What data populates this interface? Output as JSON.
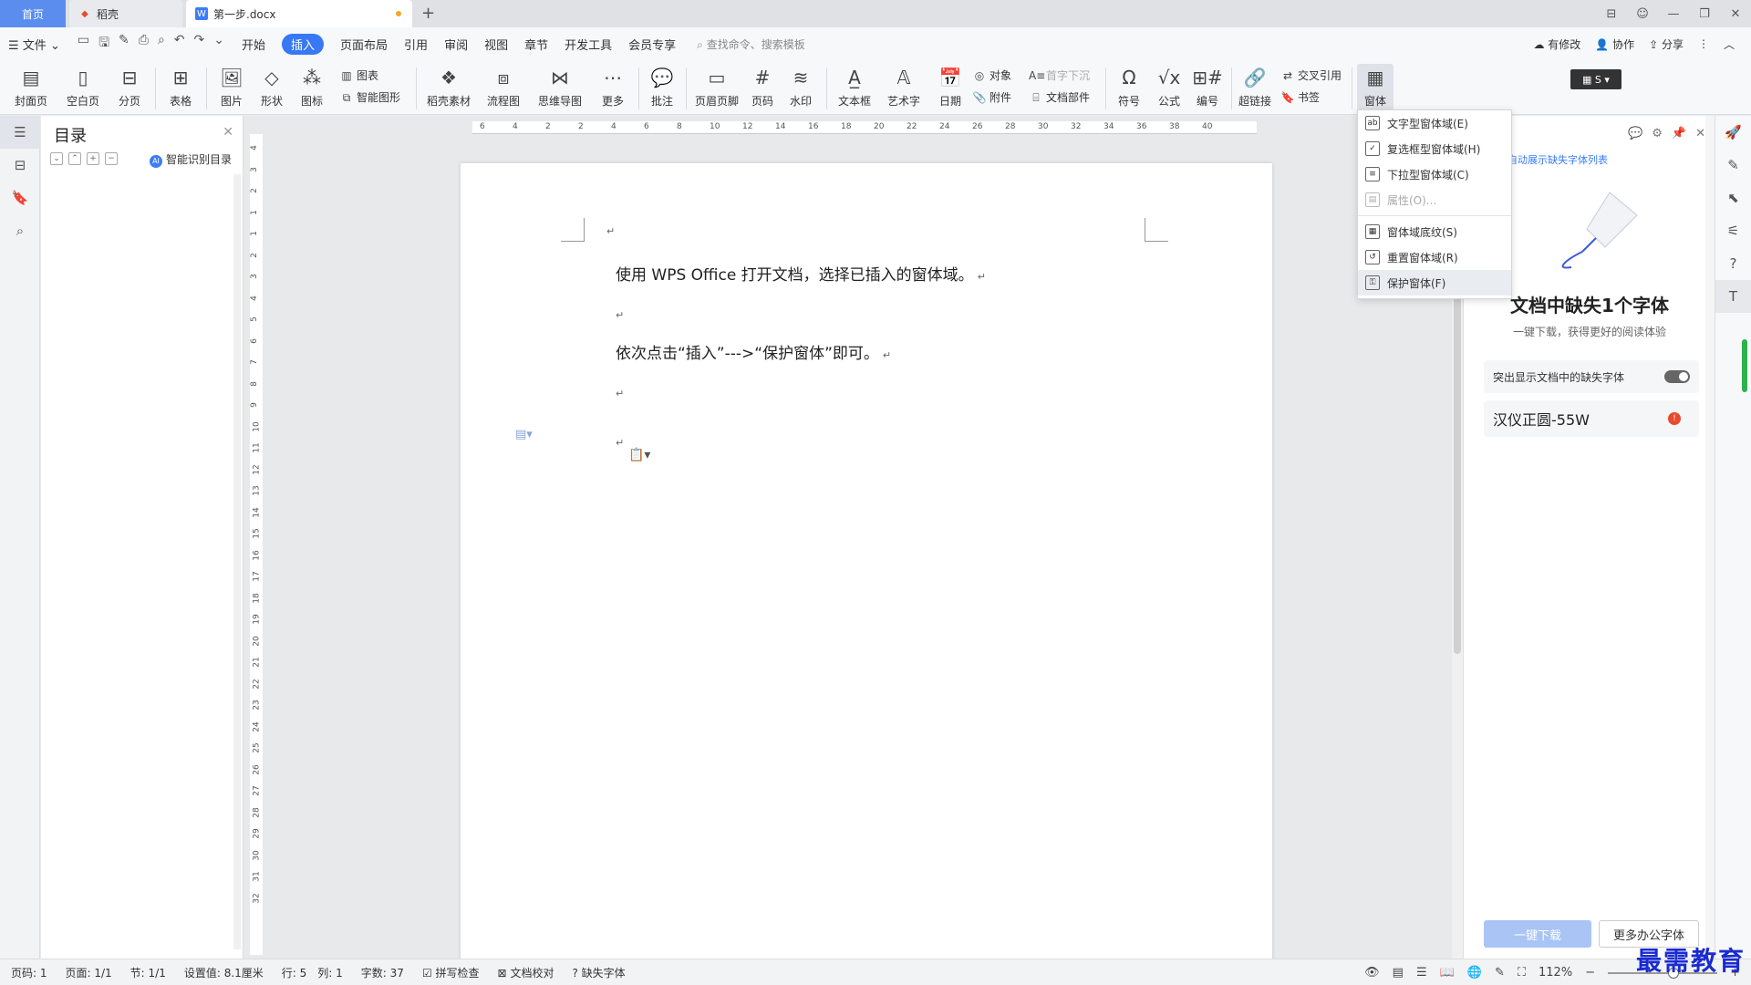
{
  "tabs": {
    "home": "首页",
    "daoke": "稻壳",
    "doc": "第一步.docx"
  },
  "menubar": {
    "file": "文件",
    "items": [
      "开始",
      "插入",
      "页面布局",
      "引用",
      "审阅",
      "视图",
      "章节",
      "开发工具",
      "会员专享"
    ],
    "active": "插入",
    "search_placeholder": "查找命令、搜索模板",
    "modify": "有修改",
    "collab": "协作",
    "share": "分享"
  },
  "ribbon": {
    "cover": "封面页",
    "blank": "空白页",
    "pagebreak": "分页",
    "table": "表格",
    "picture": "图片",
    "shape": "形状",
    "icon": "图标",
    "chart": "图表",
    "smartart": "智能图形",
    "material": "稻壳素材",
    "flowchart": "流程图",
    "mindmap": "思维导图",
    "more": "更多",
    "comment": "批注",
    "header_footer": "页眉页脚",
    "page_num": "页码",
    "watermark": "水印",
    "textbox": "文本框",
    "wordart": "艺术字",
    "date": "日期",
    "object": "对象",
    "attachment": "附件",
    "dropcap": "首字下沉",
    "docpart": "文档部件",
    "symbol": "符号",
    "formula": "公式",
    "numbering": "编号",
    "hyperlink": "超链接",
    "crossref": "交叉引用",
    "bookmark": "书签",
    "form": "窗体"
  },
  "dropdown": {
    "items": [
      {
        "label": "文字型窗体域(E)",
        "icon": "abl",
        "disabled": false
      },
      {
        "label": "复选框型窗体域(H)",
        "icon": "✓",
        "disabled": false
      },
      {
        "label": "下拉型窗体域(C)",
        "icon": "≡",
        "disabled": false
      },
      {
        "label": "属性(O)...",
        "icon": "▤",
        "disabled": true
      },
      {
        "label": "窗体域底纹(S)",
        "icon": "▦",
        "disabled": false
      },
      {
        "label": "重置窗体域(R)",
        "icon": "↺",
        "disabled": false
      },
      {
        "label": "保护窗体(F)",
        "icon": "🔒",
        "disabled": false
      }
    ]
  },
  "toc": {
    "title": "目录",
    "smart": "智能识别目录",
    "ai_badge": "AI"
  },
  "document": {
    "para1": "使用 WPS Office 打开文档，选择已插入的窗体域。",
    "para2": "依次点击“插入”--->“保护窗体”即可。",
    "pmark": "↵"
  },
  "ruler": {
    "h": [
      "6",
      "4",
      "2",
      "2",
      "4",
      "6",
      "8",
      "10",
      "12",
      "14",
      "16",
      "18",
      "20",
      "22",
      "24",
      "26",
      "28",
      "30",
      "32",
      "34",
      "36",
      "38",
      "40"
    ],
    "v": [
      "4",
      "3",
      "2",
      "1",
      "1",
      "2",
      "3",
      "4",
      "5",
      "6",
      "7",
      "8",
      "9",
      "10",
      "11",
      "12",
      "13",
      "14",
      "15",
      "16",
      "17",
      "18",
      "19",
      "20",
      "21",
      "22",
      "23",
      "24",
      "25",
      "26",
      "27",
      "28",
      "29",
      "30",
      "31",
      "32"
    ]
  },
  "rightpanel": {
    "link": "自动展示缺失字体列表",
    "title": "文档中缺失1个字体",
    "subtitle": "一键下载，获得更好的阅读体验",
    "toggle_label": "突出显示文档中的缺失字体",
    "font_name": "汉仪正圆-55W",
    "download": "一键下载",
    "more_fonts": "更多办公字体"
  },
  "status": {
    "page_code": "页码: 1",
    "page": "页面: 1/1",
    "section": "节: 1/1",
    "setting": "设置值: 8.1厘米",
    "row": "行: 5",
    "col": "列: 1",
    "words": "字数: 37",
    "spell": "拼写检查",
    "proof": "文档校对",
    "missing_font": "缺失字体",
    "zoom": "112%"
  },
  "watermark_text": "最需教育",
  "colors": {
    "accent": "#3778f4",
    "home_tab": "#5b8def",
    "warn": "#e84b2c",
    "green": "#2bb24c"
  }
}
